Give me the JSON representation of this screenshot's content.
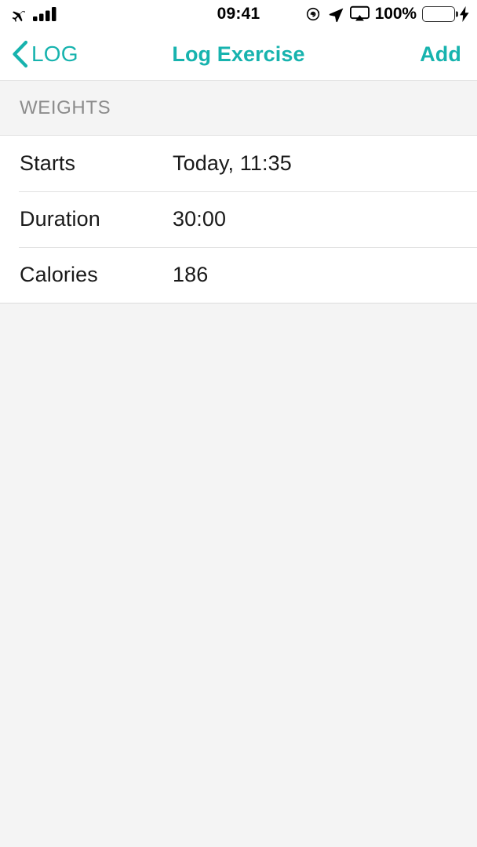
{
  "status_bar": {
    "airplane_icon": "airplane-mode-icon",
    "signal_icon": "cellular-signal-bars-icon",
    "time": "09:41",
    "rotation_lock_icon": "rotation-lock-icon",
    "location_icon": "location-arrow-icon",
    "airplay_icon": "airplay-screen-mirroring-icon",
    "battery_percent": "100%",
    "battery_icon": "battery-full-icon",
    "charging_icon": "charging-bolt-icon",
    "battery_color": "#2fd157",
    "time_color": "#000000"
  },
  "nav_bar": {
    "back_icon": "chevron-left-icon",
    "back_label": "LOG",
    "title": "Log Exercise",
    "add_label": "Add",
    "accent_color": "#17b3ae"
  },
  "section": {
    "header": "WEIGHTS",
    "header_color": "#8c8c8c",
    "rows": [
      {
        "label": "Starts",
        "value": "Today, 11:35"
      },
      {
        "label": "Duration",
        "value": "30:00"
      },
      {
        "label": "Calories",
        "value": "186"
      }
    ]
  },
  "background_color": "#f4f4f4"
}
